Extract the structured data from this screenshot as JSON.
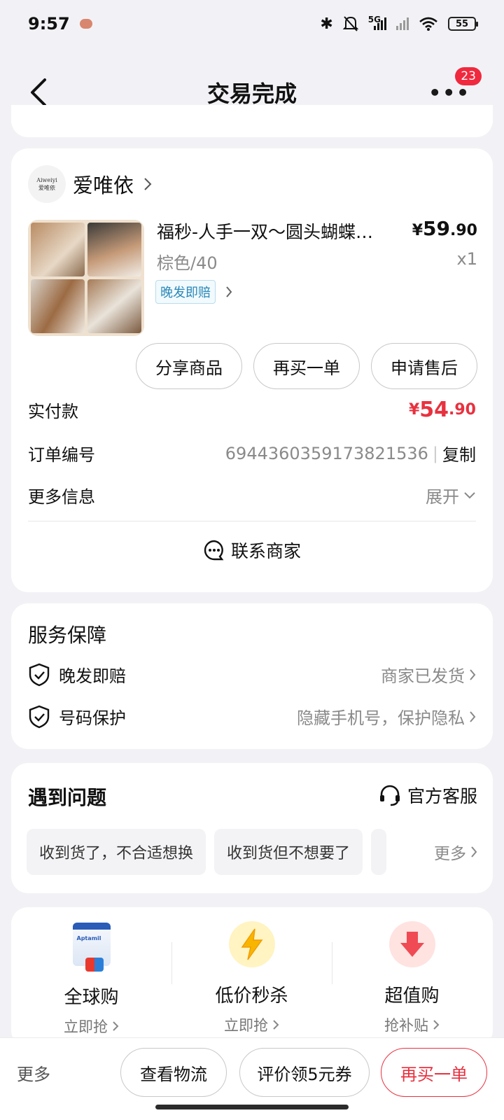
{
  "status": {
    "time": "9:57",
    "network": "5G",
    "battery": "55"
  },
  "header": {
    "title": "交易完成",
    "more_icon": "more-dots",
    "badge": "23"
  },
  "shop": {
    "logo_top": "Aiweiyi",
    "logo_bottom": "爱唯依",
    "name": "爱唯依"
  },
  "product": {
    "title": "福秒-人手一双～圆头蝴蝶…",
    "price_symbol": "¥",
    "price_int": "59",
    "price_dec": ".90",
    "spec": "棕色/40",
    "qty": "x1",
    "tag": "晚发即赔"
  },
  "actions": {
    "share": "分享商品",
    "rebuy": "再买一单",
    "aftersale": "申请售后"
  },
  "order": {
    "paid_label": "实付款",
    "paid_symbol": "¥",
    "paid_int": "54",
    "paid_dec": ".90",
    "number_label": "订单编号",
    "number": "6944360359173821536",
    "copy": "复制",
    "more_label": "更多信息",
    "expand": "展开",
    "contact": "联系商家"
  },
  "service": {
    "title": "服务保障",
    "items": [
      {
        "name": "晚发即赔",
        "value": "商家已发货"
      },
      {
        "name": "号码保护",
        "value": "隐藏手机号，保护隐私"
      }
    ]
  },
  "problems": {
    "title": "遇到问题",
    "support": "官方客服",
    "chips": [
      "收到货了，不合适想换",
      "收到货但不想要了"
    ],
    "more": "更多"
  },
  "promos": [
    {
      "name": "全球购",
      "sub": "立即抢"
    },
    {
      "name": "低价秒杀",
      "sub": "立即抢"
    },
    {
      "name": "超值购",
      "sub": "抢补贴"
    }
  ],
  "promo_can_label": "Aptamil",
  "bottom": {
    "more": "更多",
    "logistics": "查看物流",
    "review": "评价领5元券",
    "rebuy": "再买一单"
  },
  "colors": {
    "accent_red": "#e8313f",
    "tag_blue": "#2a88b8",
    "badge_red": "#f0293e"
  }
}
